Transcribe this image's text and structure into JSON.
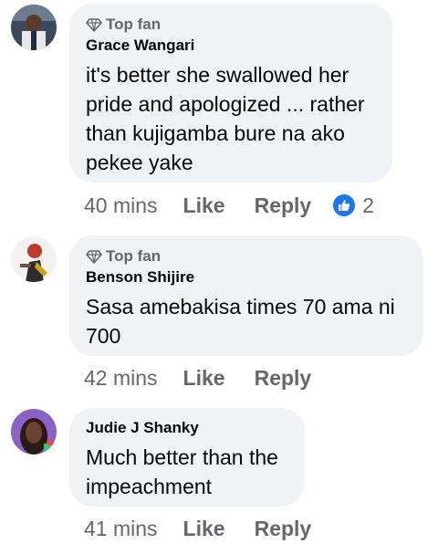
{
  "comments": [
    {
      "badge": "Top fan",
      "author": "Grace Wangari",
      "text": "it's better she swallowed her\npride and apologized ... rather\nthan kujigamba bure na ako\npekee yake",
      "time": "40 mins",
      "like_label": "Like",
      "reply_label": "Reply",
      "reaction_count": "2",
      "reaction_icon": "like-icon"
    },
    {
      "badge": "Top fan",
      "author": "Benson Shijire",
      "text": "Sasa amebakisa times 70 ama ni\n700",
      "time": "42 mins",
      "like_label": "Like",
      "reply_label": "Reply"
    },
    {
      "author": "Judie J Shanky",
      "text": "Much better than the\nimpeachment",
      "time": "41 mins",
      "like_label": "Like",
      "reply_label": "Reply"
    }
  ],
  "colors": {
    "bubble": "#f0f2f5",
    "meta": "#65676b",
    "accent": "#1877f2"
  }
}
